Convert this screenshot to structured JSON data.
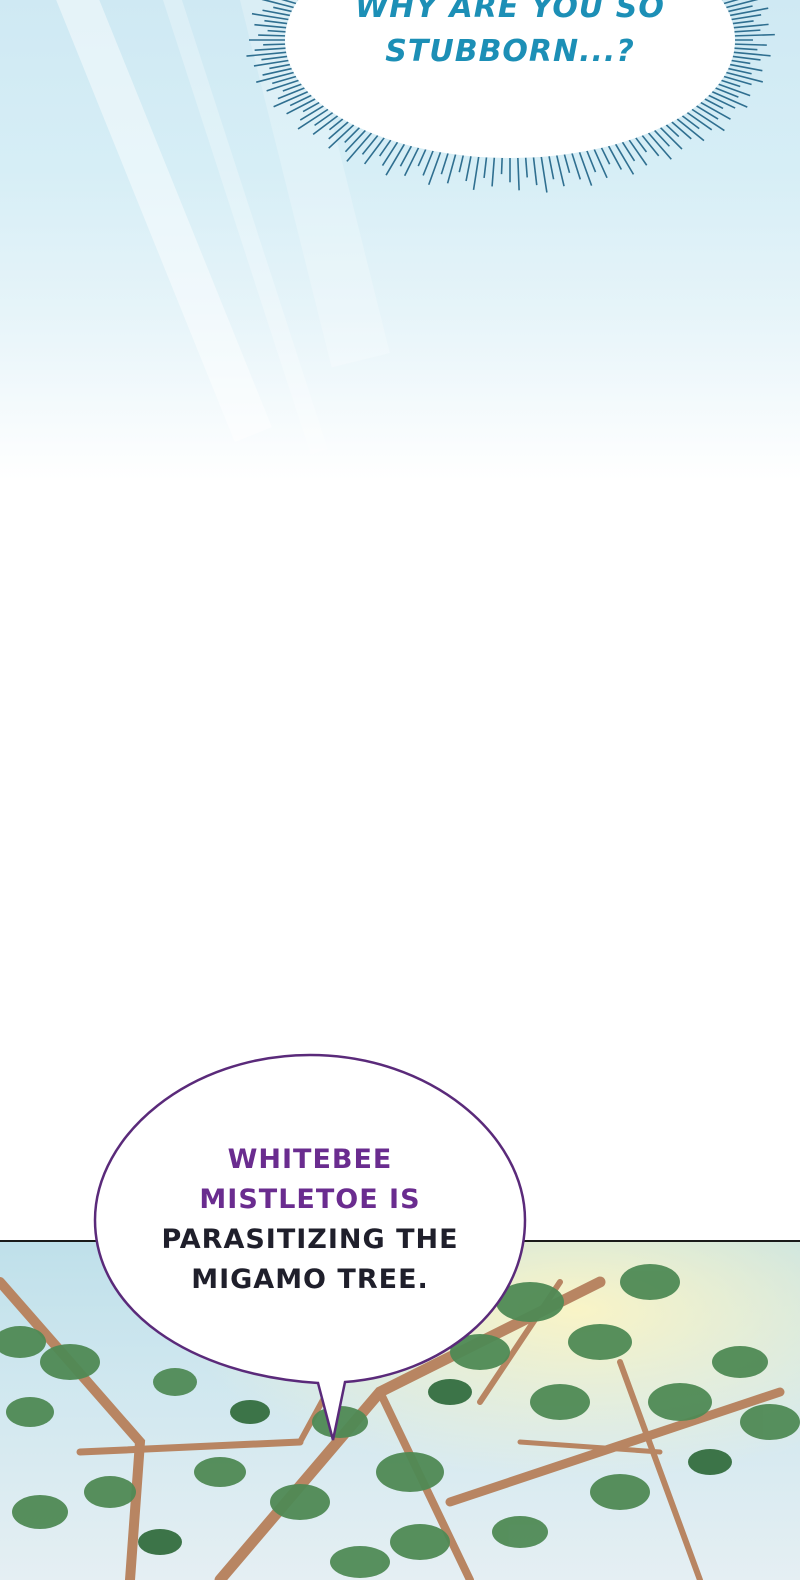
{
  "panels": {
    "top": {
      "bubble_line1": "WHY ARE YOU SO",
      "bubble_line2": "STUBBORN...?",
      "text_color": "#1c8fb6"
    },
    "bottom": {
      "speech_line1": "WHITEBEE",
      "speech_line2": "MISTLETOE IS",
      "speech_line3": "PARASITIZING THE",
      "speech_line4": "MIGAMO TREE.",
      "highlight_color": "#6a2c8f",
      "bubble_border_color": "#5a2a7a"
    }
  }
}
